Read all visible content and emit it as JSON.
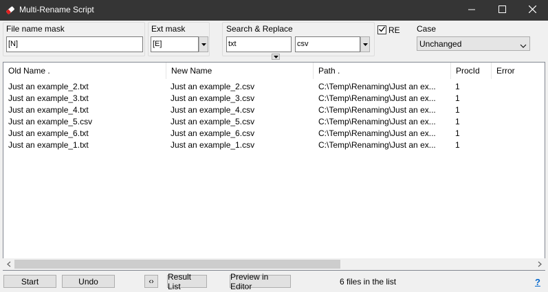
{
  "window": {
    "title": "Multi-Rename Script"
  },
  "masks": {
    "file_name_label": "File name mask",
    "file_name_value": "[N]",
    "ext_label": "Ext mask",
    "ext_value": "[E]"
  },
  "search_replace": {
    "label": "Search  &  Replace",
    "search_value": "txt",
    "replace_value": "csv",
    "re_label": "RE",
    "re_checked": true
  },
  "case": {
    "label": "Case",
    "selected": "Unchanged"
  },
  "table": {
    "columns": [
      "Old Name .",
      "New Name",
      "Path .",
      "ProcId",
      "Error"
    ],
    "rows": [
      [
        "Just an example_2.txt",
        "Just an example_2.csv",
        "C:\\Temp\\Renaming\\Just an ex...",
        "1",
        ""
      ],
      [
        "Just an example_3.txt",
        "Just an example_3.csv",
        "C:\\Temp\\Renaming\\Just an ex...",
        "1",
        ""
      ],
      [
        "Just an example_4.txt",
        "Just an example_4.csv",
        "C:\\Temp\\Renaming\\Just an ex...",
        "1",
        ""
      ],
      [
        "Just an example_5.csv",
        "Just an example_5.csv",
        "C:\\Temp\\Renaming\\Just an ex...",
        "1",
        ""
      ],
      [
        "Just an example_6.txt",
        "Just an example_6.csv",
        "C:\\Temp\\Renaming\\Just an ex...",
        "1",
        ""
      ],
      [
        "Just an example_1.txt",
        "Just an example_1.csv",
        "C:\\Temp\\Renaming\\Just an ex...",
        "1",
        ""
      ]
    ]
  },
  "buttons": {
    "start": "Start",
    "undo": "Undo",
    "reload": "‹›",
    "result_list": "Result List",
    "preview": "Preview in Editor"
  },
  "status": "6 files in the list",
  "help": "?",
  "icons": {
    "app": "eraser-icon",
    "minimize": "minimize-icon",
    "maximize": "maximize-icon",
    "close": "close-icon"
  },
  "colors": {
    "titlebar": "#353535",
    "window_bg": "#f0f0f0",
    "help_link": "#0066cc"
  }
}
